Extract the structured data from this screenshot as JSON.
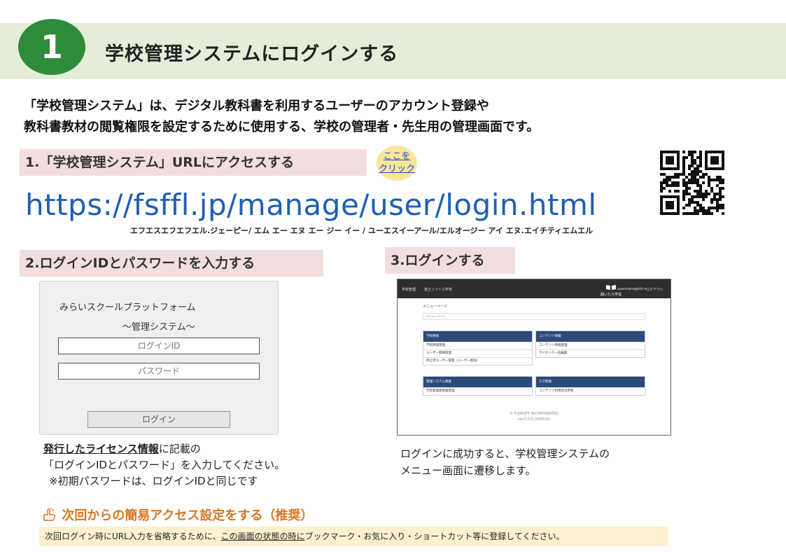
{
  "header": {
    "section_number": "1",
    "title": "学校管理システムにログインする"
  },
  "intro": {
    "line1": "「学校管理システム」は、デジタル教科書を利用するユーザーのアカウント登録や",
    "line2": "教科書教材の閲覧権限を設定するために使用する、学校の管理者・先生用の管理画面です。"
  },
  "step1": {
    "label": "1.「学校管理システム」URLにアクセスする",
    "click_line1": "ここを",
    "click_line2": "クリック",
    "url": "https://fsffl.jp/manage/user/login.html",
    "url_reading": "エフエスエフエフエル.ジェーピー/ エム エー エヌ エー ジー イー / ユーエスイーアール/エルオージー アイ エヌ.エイチティエムエル"
  },
  "step2": {
    "label": "2.ログインIDとパスワードを入力する",
    "form": {
      "platform_name": "みらいスクールプラットフォーム",
      "system_name": "～管理システム～",
      "id_placeholder": "ログインID",
      "password_placeholder": "パスワード",
      "login_button": "ログイン"
    },
    "note_link": "発行したライセンス情報",
    "note_line1_rest": "に記載の",
    "note_line2": "「ログインIDとパスワード」を入力してください。",
    "note_line3": "※初期パスワードは、ログインIDと同じです"
  },
  "step3": {
    "label": "3.ログインする",
    "screenshot": {
      "bar_left": "学校管理",
      "bar_school": "富士ソフト小学校",
      "bar_book": "開いたら学習",
      "bar_user": "usermanagefsi ▾",
      "bar_logout": "ログアウト",
      "page_title": "メニューページ",
      "breadcrumb": "メニューページ",
      "cards": [
        {
          "title": "学校情報",
          "rows": [
            "学校情報管理",
            "ユーザー情報管理",
            "停止済ユーザー管理（ユーザー削除）"
          ]
        },
        {
          "title": "コンテンツ情報",
          "rows": [
            "コンテンツ情報管理",
            "ライセンス一括編集"
          ]
        },
        {
          "title": "管理システム情報",
          "rows": [
            "学校管理者情報管理"
          ]
        },
        {
          "title": "ログ情報",
          "rows": [
            "コンテンツ利用状況参照"
          ]
        }
      ],
      "footer_copyright": "© FUJISOFT INCORPORATED",
      "footer_version": "ver.5.0.0 (240516)"
    },
    "note_line1": "ログインに成功すると、学校管理システムの",
    "note_line2": "メニュー画面に遷移します。"
  },
  "tip": {
    "title": "次回からの簡易アクセス設定をする（推奨）",
    "text_before": "次回ログイン時にURL入力を省略するために、",
    "text_underlined": "この画面の状態の時に",
    "text_after": "ブックマーク・お気に入り・ショートカット等に登録してください。"
  },
  "colors": {
    "header_band": "#e3edd7",
    "section_circle": "#2e8b3a",
    "step_label_bg": "#f2dede",
    "url_blue": "#1f5fb3",
    "click_badge": "#fbe59b",
    "tip_orange": "#d9751e",
    "tip_box_bg": "#fcf0cf",
    "menu_card_head": "#2c4a7a"
  },
  "icons": {
    "tip_icon": "pointing-hand-icon",
    "qr": "qr-code-icon",
    "book": "book-icon"
  }
}
